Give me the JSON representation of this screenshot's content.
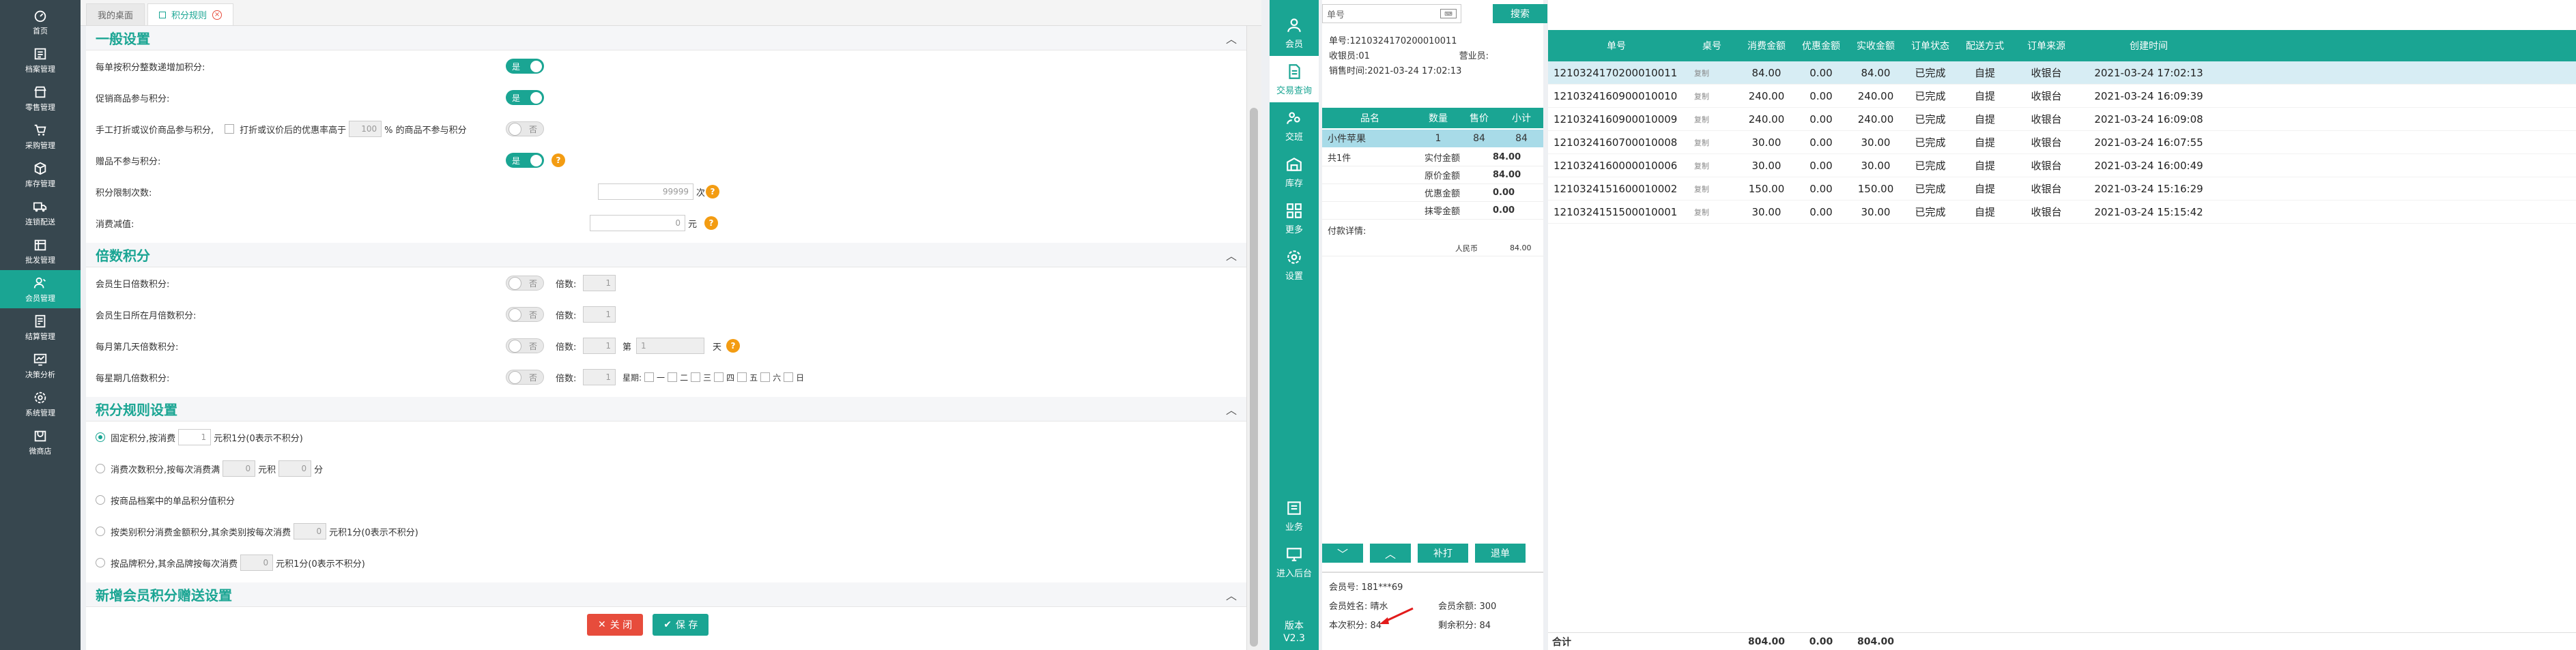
{
  "nav": [
    {
      "label": "首页",
      "icon": "dashboard-icon"
    },
    {
      "label": "档案管理",
      "icon": "archive-icon"
    },
    {
      "label": "零售管理",
      "icon": "retail-icon"
    },
    {
      "label": "采购管理",
      "icon": "cart-icon"
    },
    {
      "label": "库存管理",
      "icon": "box-icon"
    },
    {
      "label": "连锁配送",
      "icon": "truck-icon"
    },
    {
      "label": "批发管理",
      "icon": "wholesale-icon"
    },
    {
      "label": "会员管理",
      "icon": "member-icon"
    },
    {
      "label": "结算管理",
      "icon": "settle-icon"
    },
    {
      "label": "决策分析",
      "icon": "chart-icon"
    },
    {
      "label": "系统管理",
      "icon": "gear-icon"
    },
    {
      "label": "微商店",
      "icon": "shop-icon"
    }
  ],
  "tabs": {
    "home": "我的桌面",
    "active": "积分规则",
    "close": "×"
  },
  "sections": {
    "general": "一般设置",
    "multiple": "倍数积分",
    "rules": "积分规则设置",
    "newmember": "新增会员积分赠送设置"
  },
  "general": {
    "r1": "每单按积分整数递增加积分:",
    "r2": "促销商品参与积分:",
    "r3a": "手工打折或议价商品参与积分,",
    "r3b": "打折或议价后的优惠率高于",
    "r3c": "100",
    "r3d": "% 的商品不参与积分",
    "r4": "赠品不参与积分:",
    "r5": "积分限制次数:",
    "r5v": "99999",
    "r5u": "次",
    "r6": "消费减值:",
    "r6v": "0",
    "r6u": "元",
    "on": "是",
    "off": "否",
    "q": "?"
  },
  "multiple": {
    "r1": "会员生日倍数积分:",
    "r2": "会员生日所在月倍数积分:",
    "r3": "每月第几天倍数积分:",
    "r4": "每星期几倍数积分:",
    "bei": "倍数:",
    "one": "1",
    "di": "第",
    "tian": "天",
    "xq": "星期:",
    "days": [
      "一",
      "二",
      "三",
      "四",
      "五",
      "六",
      "日"
    ]
  },
  "rules": {
    "r1a": "固定积分,按消费",
    "r1b": "1",
    "r1c": "元积1分(0表示不积分)",
    "r2a": "消费次数积分,按每次消费满",
    "r2b": "0",
    "r2c": "元积",
    "r2d": "0",
    "r2e": "分",
    "r3": "按商品档案中的单品积分值积分",
    "r4a": "按类别积分消费金额积分,其余类别按每次消费",
    "r4b": "0",
    "r4c": "元积1分(0表示不积分)",
    "r5a": "按品牌积分,其余品牌按每次消费",
    "r5b": "0",
    "r5c": "元积1分(0表示不积分)"
  },
  "buttons": {
    "close": "关 闭",
    "save": "保 存"
  },
  "pos_nav": [
    {
      "label": "会员",
      "icon": "user-icon"
    },
    {
      "label": "交易查询",
      "icon": "document-icon"
    },
    {
      "label": "交班",
      "icon": "shift-icon"
    },
    {
      "label": "库存",
      "icon": "warehouse-icon"
    },
    {
      "label": "更多",
      "icon": "grid-icon"
    },
    {
      "label": "设置",
      "icon": "settings-icon"
    },
    {
      "label": "业务",
      "icon": "business-icon"
    },
    {
      "label": "进入后台",
      "icon": "monitor-icon"
    }
  ],
  "version": {
    "label": "版本",
    "value": "V2.3"
  },
  "search": {
    "placeholder": "单号",
    "button": "搜索"
  },
  "order": {
    "no": "单号:1210324170200010011",
    "cashier": "收银员:01",
    "sales": "营业员:",
    "time": "销售时间:2021-03-24 17:02:13",
    "cols": [
      "品名",
      "数量",
      "售价",
      "小计"
    ],
    "item": {
      "name": "小件苹果",
      "qty": "1",
      "price": "84",
      "sub": "84"
    },
    "count": "共1件",
    "totals": [
      [
        "实付金额",
        "84.00"
      ],
      [
        "原价金额",
        "84.00"
      ],
      [
        "优惠金额",
        "0.00"
      ],
      [
        "抹零金额",
        "0.00"
      ]
    ],
    "paylabel": "付款详情:",
    "pay": [
      "人民币",
      "84.00"
    ],
    "btn_reprint": "补打",
    "btn_return": "退单",
    "member": {
      "no": "会员号: 181***69",
      "name": "会员姓名: 晴水",
      "balance": "会员余额: 300",
      "points_now": "本次积分: 84",
      "points_left": "剩余积分: 84"
    }
  },
  "grid": {
    "headers": [
      "单号",
      "桌号",
      "消费金额",
      "优惠金额",
      "实收金额",
      "订单状态",
      "配送方式",
      "订单来源",
      "创建时间"
    ],
    "copy": "复制",
    "rows": [
      [
        "1210324170200010011",
        "84.00",
        "0.00",
        "84.00",
        "已完成",
        "自提",
        "收银台",
        "2021-03-24 17:02:13"
      ],
      [
        "1210324160900010010",
        "240.00",
        "0.00",
        "240.00",
        "已完成",
        "自提",
        "收银台",
        "2021-03-24 16:09:39"
      ],
      [
        "1210324160900010009",
        "240.00",
        "0.00",
        "240.00",
        "已完成",
        "自提",
        "收银台",
        "2021-03-24 16:09:08"
      ],
      [
        "1210324160700010008",
        "30.00",
        "0.00",
        "30.00",
        "已完成",
        "自提",
        "收银台",
        "2021-03-24 16:07:55"
      ],
      [
        "1210324160000010006",
        "30.00",
        "0.00",
        "30.00",
        "已完成",
        "自提",
        "收银台",
        "2021-03-24 16:00:49"
      ],
      [
        "1210324151600010002",
        "150.00",
        "0.00",
        "150.00",
        "已完成",
        "自提",
        "收银台",
        "2021-03-24 15:16:29"
      ],
      [
        "1210324151500010001",
        "30.00",
        "0.00",
        "30.00",
        "已完成",
        "自提",
        "收银台",
        "2021-03-24 15:15:42"
      ]
    ],
    "footer": {
      "label": "合计",
      "spent": "804.00",
      "discount": "0.00",
      "received": "804.00"
    }
  },
  "colors": {
    "accent": "#1aa593",
    "nav": "#37474f",
    "danger": "#e74c3c",
    "warn": "#f39c12"
  }
}
